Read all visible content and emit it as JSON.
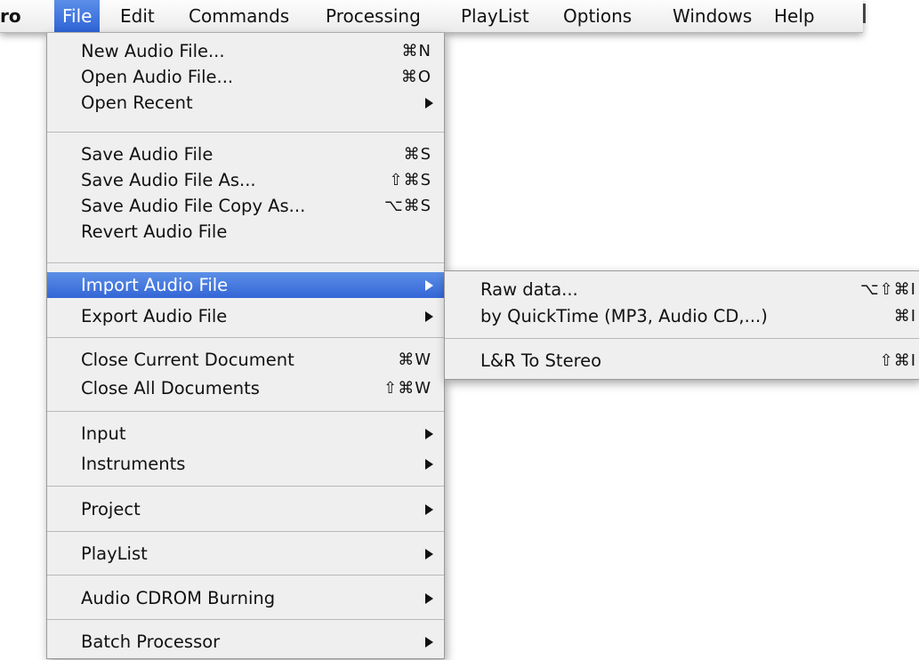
{
  "menubar": {
    "app": "ro",
    "items": [
      "File",
      "Edit",
      "Commands",
      "Processing",
      "PlayList",
      "Options",
      "Windows",
      "Help"
    ]
  },
  "file_menu": {
    "items": [
      {
        "label": "New Audio File...",
        "shortcut": "⌘N"
      },
      {
        "label": "Open Audio File...",
        "shortcut": "⌘O"
      },
      {
        "label": "Open Recent",
        "submenu": true
      },
      {
        "label": "Save Audio File",
        "shortcut": "⌘S"
      },
      {
        "label": "Save Audio File As...",
        "shortcut": "⇧⌘S"
      },
      {
        "label": "Save Audio File Copy As...",
        "shortcut": "⌥⌘S"
      },
      {
        "label": "Revert Audio File"
      },
      {
        "label": "Import Audio File",
        "submenu": true,
        "highlighted": true
      },
      {
        "label": "Export Audio File",
        "submenu": true
      },
      {
        "label": "Close Current Document",
        "shortcut": "⌘W"
      },
      {
        "label": "Close All Documents",
        "shortcut": "⇧⌘W"
      },
      {
        "label": "Input",
        "submenu": true
      },
      {
        "label": "Instruments",
        "submenu": true
      },
      {
        "label": "Project",
        "submenu": true
      },
      {
        "label": "PlayList",
        "submenu": true
      },
      {
        "label": "Audio CDROM Burning",
        "submenu": true
      },
      {
        "label": "Batch Processor",
        "submenu": true
      }
    ]
  },
  "import_submenu": {
    "items": [
      {
        "label": "Raw data...",
        "shortcut": "⌥⇧⌘I"
      },
      {
        "label": "by QuickTime (MP3, Audio CD,...)",
        "shortcut": "⌘I"
      },
      {
        "label": "L&R To Stereo",
        "shortcut": "⇧⌘I"
      }
    ]
  },
  "colors": {
    "highlight": "#3366d6",
    "menu_bg": "#efefef"
  }
}
